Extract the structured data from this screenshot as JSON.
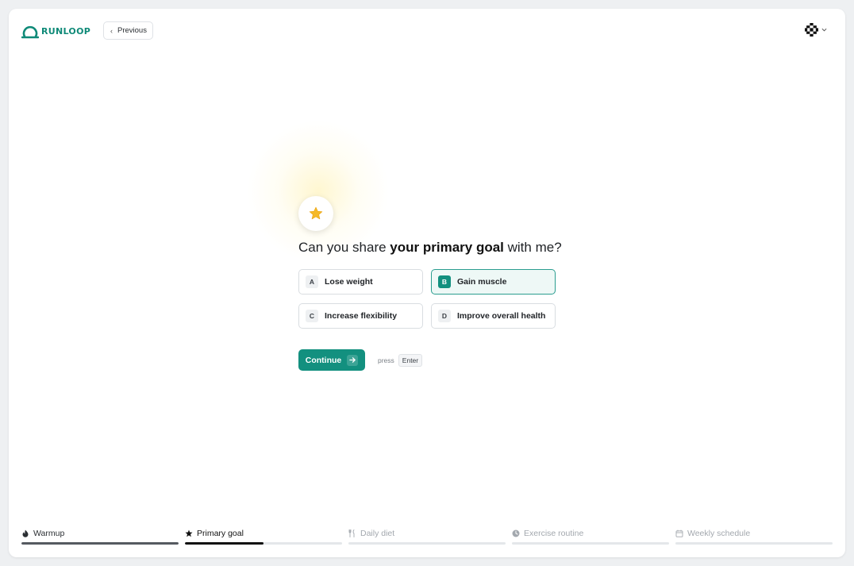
{
  "header": {
    "logo_text": "RUNLOOP",
    "previous_label": "Previous"
  },
  "question": {
    "prefix": "Can you share ",
    "emphasis": "your primary goal",
    "suffix": " with me?"
  },
  "options": [
    {
      "key": "A",
      "label": "Lose weight",
      "selected": false
    },
    {
      "key": "B",
      "label": "Gain muscle",
      "selected": true
    },
    {
      "key": "C",
      "label": "Increase flexibility",
      "selected": false
    },
    {
      "key": "D",
      "label": "Improve overall health",
      "selected": false
    }
  ],
  "continue": {
    "label": "Continue",
    "press_text": "press",
    "key_label": "Enter"
  },
  "steps": [
    {
      "label": "Warmup",
      "icon": "flame-icon",
      "state": "done",
      "progress": 1.0
    },
    {
      "label": "Primary goal",
      "icon": "star-icon",
      "state": "active",
      "progress": 0.5
    },
    {
      "label": "Daily diet",
      "icon": "utensils-icon",
      "state": "pending",
      "progress": 0
    },
    {
      "label": "Exercise routine",
      "icon": "clock-icon",
      "state": "pending",
      "progress": 0
    },
    {
      "label": "Weekly schedule",
      "icon": "calendar-icon",
      "state": "pending",
      "progress": 0
    }
  ],
  "colors": {
    "brand": "#13907f",
    "star": "#f5b928",
    "selected_bg": "#eef8f6"
  }
}
